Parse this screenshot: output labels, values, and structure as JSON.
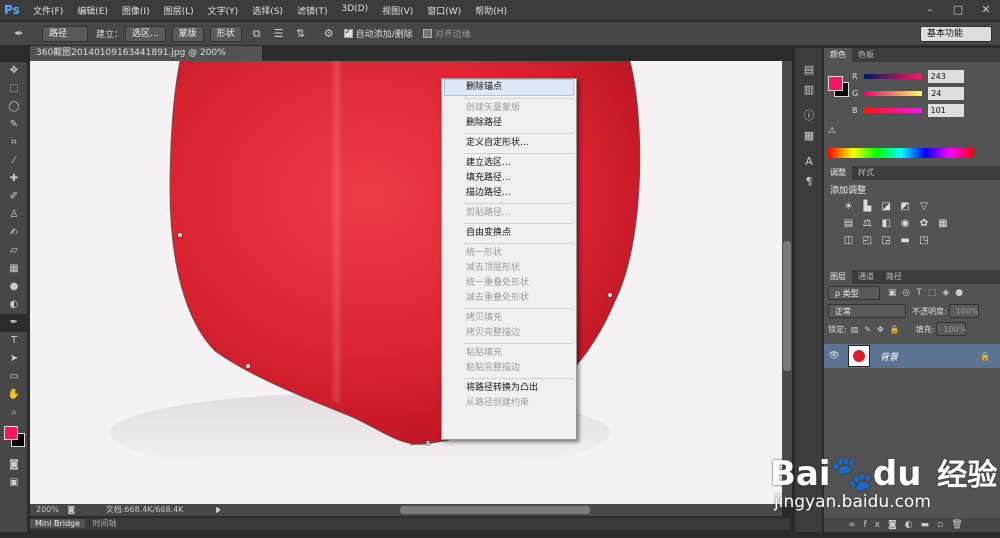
{
  "app": {
    "logo": "Ps",
    "menu": [
      "文件(F)",
      "编辑(E)",
      "图像(I)",
      "图层(L)",
      "文字(Y)",
      "选择(S)",
      "滤镜(T)",
      "3D(D)",
      "视图(V)",
      "窗口(W)",
      "帮助(H)"
    ],
    "window_controls": [
      "–",
      "□",
      "✕"
    ]
  },
  "options": {
    "mode": "路径",
    "make_label": "建立：",
    "selection_btn": "选区...",
    "mask_btn": "蒙版",
    "shape_btn": "形状",
    "auto_add_delete": "自动添加/删除",
    "align_edges": "对齐边缘",
    "workspace": "基本功能"
  },
  "document": {
    "tab_title": "360截图20140109163441891.jpg @ 200%(RGB/8#) *",
    "tab_close": "×",
    "zoom": "200%",
    "doc_info": "文档:668.4K/668.4K"
  },
  "bottom_tabs": [
    "Mini Bridge",
    "时间轴"
  ],
  "context_menu": [
    {
      "label": "删除锚点",
      "enabled": true,
      "hover": true
    },
    {
      "sep": true
    },
    {
      "label": "创建矢量蒙版",
      "enabled": false
    },
    {
      "label": "删除路径",
      "enabled": true
    },
    {
      "sep": true
    },
    {
      "label": "定义自定形状...",
      "enabled": true
    },
    {
      "sep": true
    },
    {
      "label": "建立选区...",
      "enabled": true
    },
    {
      "label": "填充路径...",
      "enabled": true
    },
    {
      "label": "描边路径...",
      "enabled": true
    },
    {
      "sep": true
    },
    {
      "label": "剪贴路径...",
      "enabled": false
    },
    {
      "sep": true
    },
    {
      "label": "自由变换点",
      "enabled": true
    },
    {
      "sep": true
    },
    {
      "label": "统一形状",
      "enabled": false
    },
    {
      "label": "减去顶层形状",
      "enabled": false
    },
    {
      "label": "统一重叠处形状",
      "enabled": false
    },
    {
      "label": "减去重叠处形状",
      "enabled": false
    },
    {
      "sep": true
    },
    {
      "label": "拷贝填充",
      "enabled": false
    },
    {
      "label": "拷贝完整描边",
      "enabled": false
    },
    {
      "sep": true
    },
    {
      "label": "粘贴填充",
      "enabled": false
    },
    {
      "label": "粘贴完整描边",
      "enabled": false
    },
    {
      "sep": true
    },
    {
      "label": "将路径转换为凸出",
      "enabled": true
    },
    {
      "label": "从路径创建约束",
      "enabled": false
    }
  ],
  "color_panel": {
    "tabs": [
      "颜色",
      "色板"
    ],
    "r_label": "R",
    "g_label": "G",
    "b_label": "B",
    "r": "243",
    "g": "24",
    "b": "101",
    "foreground": "#f31865"
  },
  "adjust_panel": {
    "tabs": [
      "调整",
      "样式"
    ],
    "title": "添加调整"
  },
  "layers_panel": {
    "tabs": [
      "图层",
      "通道",
      "路径"
    ],
    "filter": "ρ 类型",
    "blend": "正常",
    "opacity_label": "不透明度:",
    "opacity": "100%",
    "lock_label": "锁定:",
    "fill_label": "填充:",
    "fill": "100%",
    "layer_name": "背景"
  },
  "watermark": {
    "brand": "Bai",
    "brand2": "du",
    "cn": "经验",
    "url": "jingyan.baidu.com"
  }
}
